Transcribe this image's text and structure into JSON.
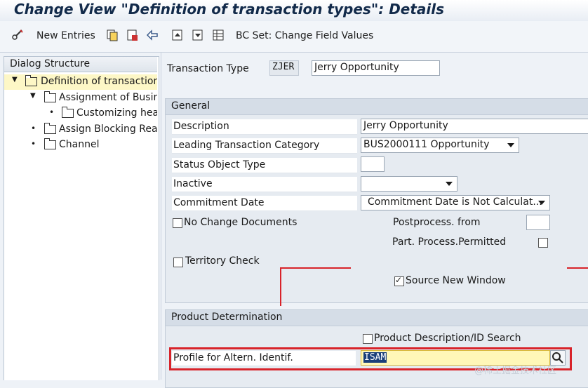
{
  "window": {
    "title": "Change View \"Definition of transaction types\": Details"
  },
  "toolbar": {
    "new_entries": "New Entries",
    "bc_set": "BC Set: Change Field Values",
    "icons": [
      "glasses-pencil-icon",
      "copy-icon",
      "delete-icon",
      "undo-icon",
      "previous-icon",
      "next-icon",
      "table-icon"
    ]
  },
  "tree": {
    "header": "Dialog Structure",
    "items": [
      {
        "label": "Definition of transaction types",
        "level": 0,
        "expanded": true,
        "selected": true,
        "open_folder": true
      },
      {
        "label": "Assignment of Business Transaction Categories",
        "level": 1,
        "expanded": true
      },
      {
        "label": "Customizing header",
        "level": 2
      },
      {
        "label": "Assign Blocking Reasons",
        "level": 0
      },
      {
        "label": "Channel",
        "level": 0
      }
    ]
  },
  "header_row": {
    "label": "Transaction Type",
    "code": "ZJER",
    "name": "Jerry Opportunity"
  },
  "general": {
    "title": "General",
    "description": {
      "label": "Description",
      "value": "Jerry Opportunity"
    },
    "leading_category": {
      "label": "Leading Transaction Category",
      "value": "BUS2000111 Opportunity"
    },
    "status_object_type": {
      "label": "Status Object Type",
      "value": ""
    },
    "inactive": {
      "label": "Inactive",
      "value": ""
    },
    "commitment_date": {
      "label": "Commitment Date",
      "value": "Commitment Date is Not Calculat..."
    },
    "no_change_docs": {
      "label": "No Change Documents",
      "checked": false
    },
    "postprocess_from": {
      "label": "Postprocess. from",
      "value": ""
    },
    "part_process": {
      "label": "Part. Process.Permitted",
      "checked": false
    },
    "territory_check": {
      "label": "Territory Check",
      "checked": false
    },
    "source_new_window": {
      "label": "Source New Window",
      "checked": true
    }
  },
  "product_determination": {
    "title": "Product Determination",
    "desc_id_search": {
      "label": "Product Description/ID Search",
      "checked": false
    },
    "profile": {
      "label": "Profile for Altern. Identif.",
      "value": "ISAM"
    }
  },
  "colors": {
    "highlight_border": "#d8232a",
    "input_focus": "#fff7b8",
    "selection_bg": "#1a3f7a"
  },
  "watermark": "@稀土掘金技术社区"
}
